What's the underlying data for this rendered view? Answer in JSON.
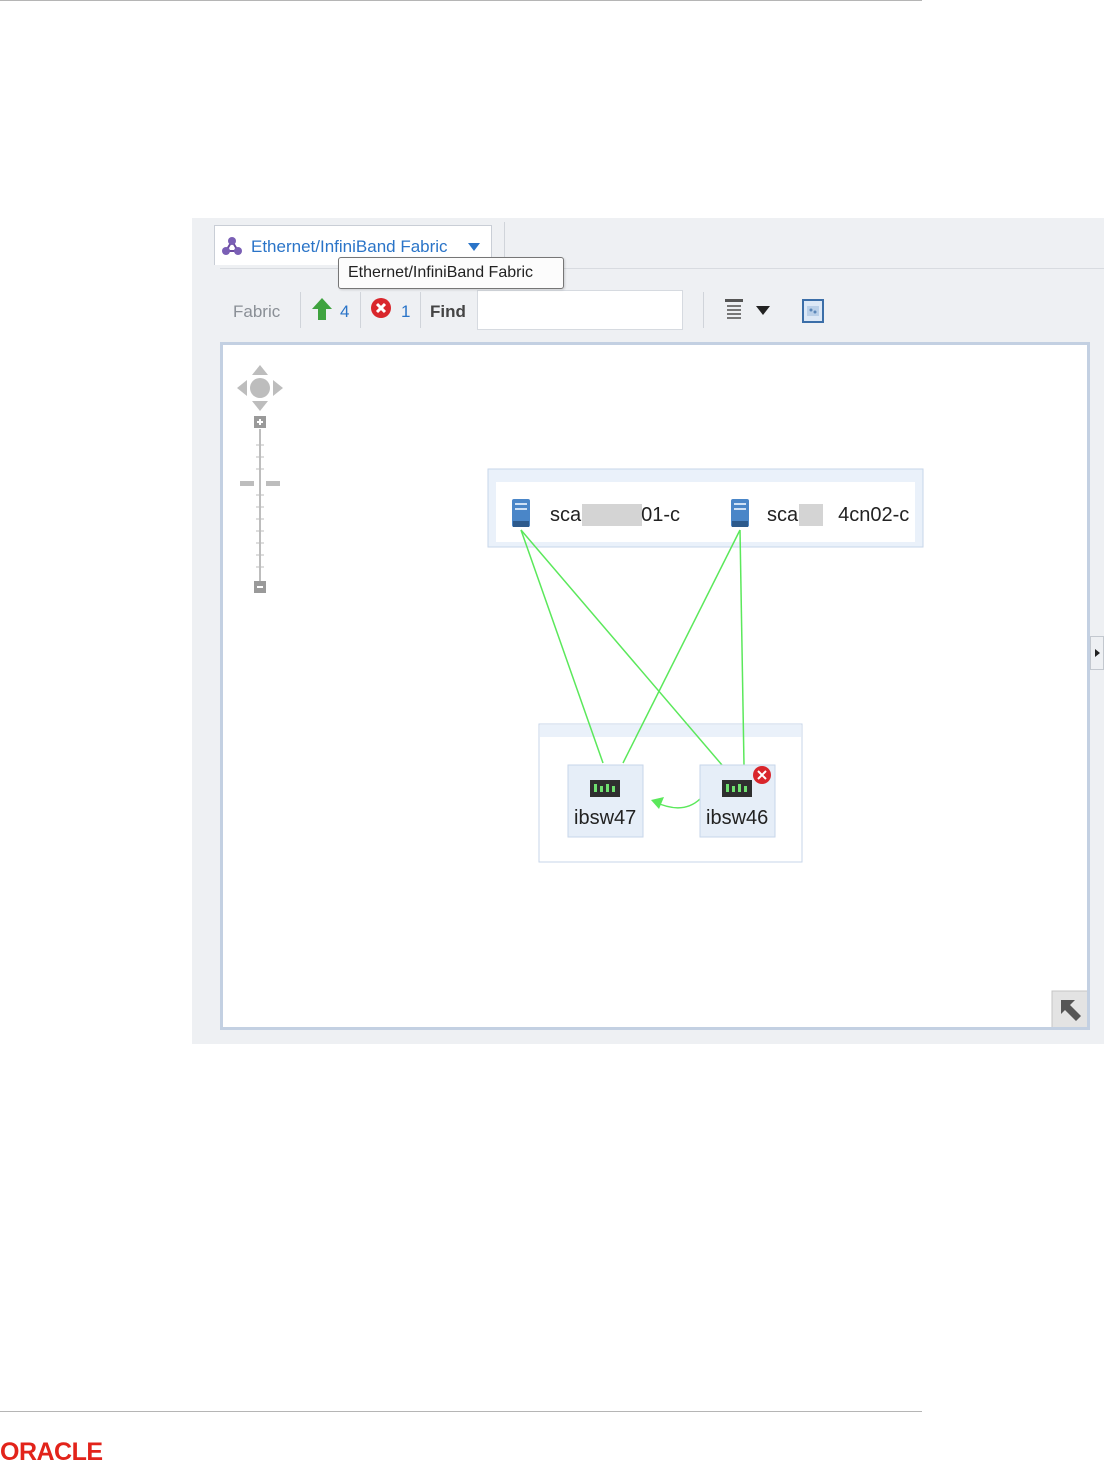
{
  "tab": {
    "label": "Ethernet/InfiniBand Fabric",
    "tooltip": "Ethernet/InfiniBand Fabric"
  },
  "toolbar": {
    "fabric_label": "Fabric",
    "up_count": "4",
    "error_count": "1",
    "find_label": "Find",
    "find_value": ""
  },
  "diagram": {
    "compute_group": {
      "nodes": [
        {
          "name": "sca   01-c",
          "icon": "server-icon"
        },
        {
          "name": "sca  4cn02-c",
          "icon": "server-icon"
        }
      ]
    },
    "switch_group": {
      "nodes": [
        {
          "name": "ibsw47",
          "icon": "switch-icon",
          "status": "ok"
        },
        {
          "name": "ibsw46",
          "icon": "switch-icon",
          "status": "error"
        }
      ]
    },
    "link_color": "#5be85b"
  },
  "footer": {
    "logo_text": "ORACLE"
  },
  "colors": {
    "accent": "#2a74c8",
    "error": "#d9262c",
    "up": "#3fa33f",
    "brand": "#e2231a"
  }
}
